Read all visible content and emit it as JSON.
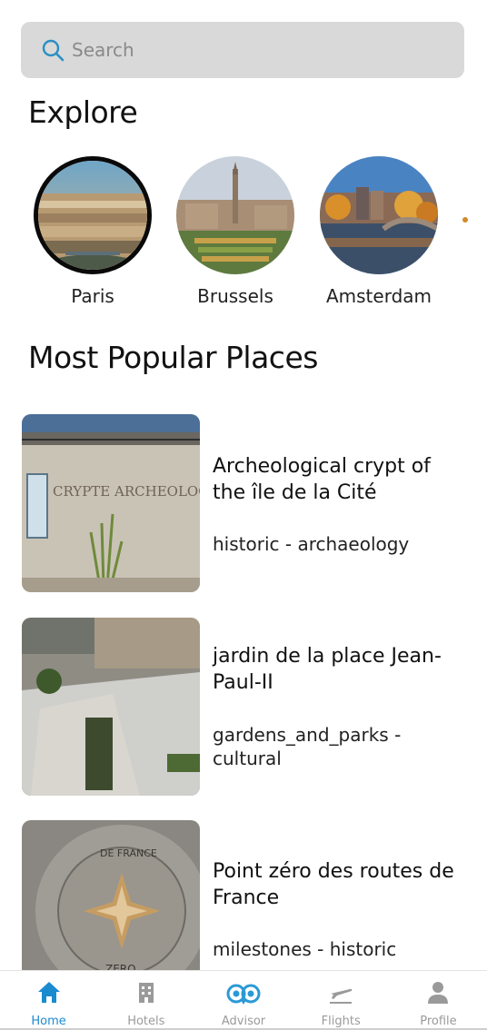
{
  "search": {
    "placeholder": "Search"
  },
  "explore": {
    "heading": "Explore",
    "cities": [
      {
        "name": "Paris",
        "selected": true
      },
      {
        "name": "Brussels",
        "selected": false
      },
      {
        "name": "Amsterdam",
        "selected": false
      }
    ]
  },
  "popular": {
    "heading": "Most Popular Places",
    "places": [
      {
        "title": "Archeological crypt of the île de la Cité",
        "tags": "historic - archaeology"
      },
      {
        "title": "jardin de la place Jean-Paul-II",
        "tags": "gardens_and_parks - cultural"
      },
      {
        "title": "Point zéro des routes de France",
        "tags": "milestones - historic"
      }
    ]
  },
  "nav": {
    "items": [
      {
        "label": "Home",
        "icon": "home-icon",
        "active": true
      },
      {
        "label": "Hotels",
        "icon": "hotel-icon",
        "active": false
      },
      {
        "label": "Advisor",
        "icon": "owl-icon",
        "active": false
      },
      {
        "label": "Flights",
        "icon": "plane-icon",
        "active": false
      },
      {
        "label": "Profile",
        "icon": "person-icon",
        "active": false
      }
    ]
  },
  "colors": {
    "accent": "#1b8bd0",
    "search_bg": "#d9d9d9",
    "inactive": "#9a9a9a"
  }
}
